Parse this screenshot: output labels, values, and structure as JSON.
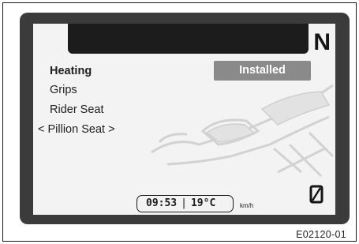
{
  "display": {
    "gear_indicator": "N",
    "menu": {
      "title": "Heating",
      "items": [
        "Grips",
        "Rider Seat",
        "< Pillion Seat >"
      ],
      "status_button": "Installed"
    },
    "info_bar": {
      "time": "09:53",
      "separator": "|",
      "temperature": "19°C",
      "speed_unit": "km/h"
    },
    "zero_icon": "slashed-zero-icon",
    "colors": {
      "bezel": "#3b3b3b",
      "screen": "#f3f3f3",
      "status_button": "#8a8a8a"
    }
  },
  "figure_id": "E02120-01"
}
